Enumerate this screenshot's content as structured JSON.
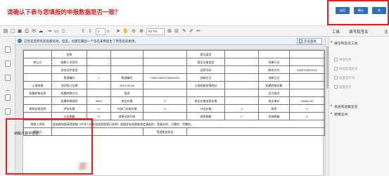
{
  "header": {
    "title": "请确认下表与您填报的申报数据是否一致？",
    "buttons": [
      "返回",
      "确认",
      "关"
    ]
  },
  "toolbar": {
    "page_current": "1",
    "page_total": "/1",
    "zoom": "83.7%",
    "tabs": [
      "工具",
      "填写和签名",
      "注"
    ]
  },
  "notice": {
    "text": "已签名且所有签名都有效，但是，也需在最后一个签名采用后生了所签名的更改。",
    "button": "签名面板"
  },
  "sidebar": {
    "section1": "填写和签名工具",
    "items": [
      "添加文本",
      "添加复选标记",
      "放置首字母",
      "放置签名"
    ],
    "section2": "发送和收集签名",
    "section3": "使用证书"
  },
  "form": {
    "rows": [
      [
        "",
        "名称",
        "",
        "",
        "",
        "登记类型",
        "",
        "",
        ""
      ],
      [
        "转让方",
        "纳税人识别号",
        "",
        "",
        "",
        "登记注册类型",
        "",
        "所属行业",
        ""
      ],
      [
        "",
        "身份证件类型",
        "",
        "",
        "",
        "证照号码",
        "",
        "联系方式",
        "15637039XXXX"
      ],
      [
        "",
        "税源编号",
        "1",
        "税源编号",
        "T440103201708001021",
        "创收总日",
        "",
        "创收日日",
        ""
      ],
      [
        "土地房屋",
        "合同签订日期",
        "",
        "2017-09-08",
        "",
        "土地房屋坐落地址",
        "",
        "权属转移对象",
        ""
      ],
      [
        "权属转移信息",
        "权属转移方式",
        "",
        "用途",
        "",
        "",
        "",
        "买方首次",
        ""
      ],
      [
        "",
        "权属转移面积",
        "5600",
        "成交价格",
        "0",
        "成交价格适用价格",
        "",
        "成交单价",
        "54654.00"
      ],
      [
        "税款征收信息",
        "评估价格",
        "0",
        "外部门交易价格",
        "0",
        "计征价格",
        "0",
        "税率",
        "0"
      ],
      [
        "",
        "计征税额",
        "0",
        "减免性质代码",
        "",
        "减免税额",
        "0",
        "应纳税额",
        "0"
      ],
      [
        "纳税人声明",
        "此纳税申报表是根据《中华人民共和国契税暂行条例》和国家有关税收规定填报的，是真实的、可靠的、完整的。",
        "",
        "",
        "",
        "",
        "",
        "",
        ""
      ],
      [
        "受理人",
        "",
        "",
        "",
        "受理税务机关",
        "",
        "",
        "",
        ""
      ]
    ]
  },
  "signature": {
    "label": "纳税人数字签名："
  },
  "colors": {
    "accent_red": "#e41e1e",
    "button_blue": "#2f6fb5",
    "title_red": "#d22222"
  }
}
